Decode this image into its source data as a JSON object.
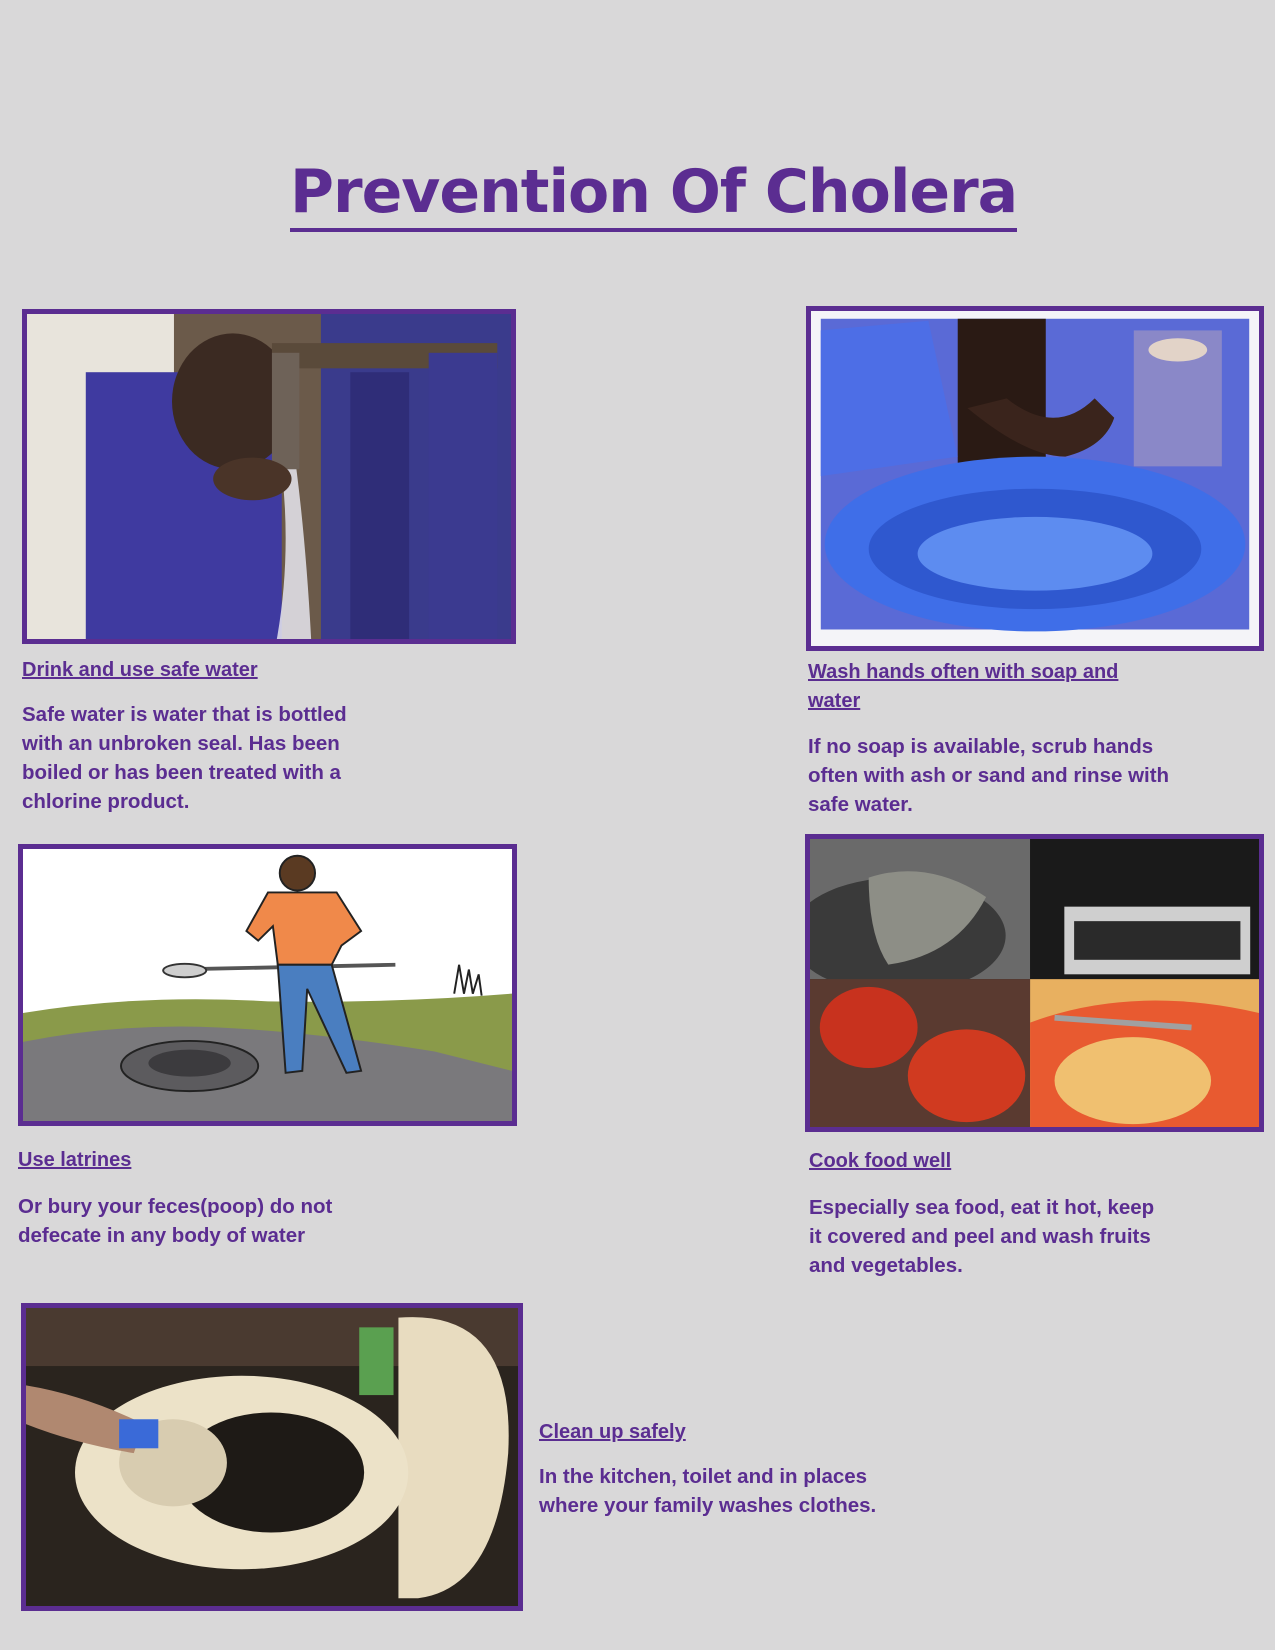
{
  "page": {
    "title": "Prevention Of Cholera"
  },
  "sections": [
    {
      "id": "drink",
      "heading": "Drink and use safe water",
      "text": "Safe water is water that is bottled with an unbroken seal. Has been boiled or has been treated with a chlorine product."
    },
    {
      "id": "wash",
      "heading": "Wash hands often with soap and water",
      "text": "If no soap is available, scrub hands often with ash or sand and rinse with safe water."
    },
    {
      "id": "latrines",
      "heading": "Use latrines",
      "text": "Or bury your feces(poop) do not defecate in any body of water"
    },
    {
      "id": "cook",
      "heading": "Cook food well",
      "text": "Especially sea food, eat it hot, keep it covered and peel and wash fruits and vegetables."
    },
    {
      "id": "clean",
      "heading": "Clean up safely",
      "text": "In the kitchen, toilet and in places where your family washes clothes."
    }
  ],
  "colors": {
    "accent": "#5b2d91",
    "background": "#d9d8d9"
  }
}
